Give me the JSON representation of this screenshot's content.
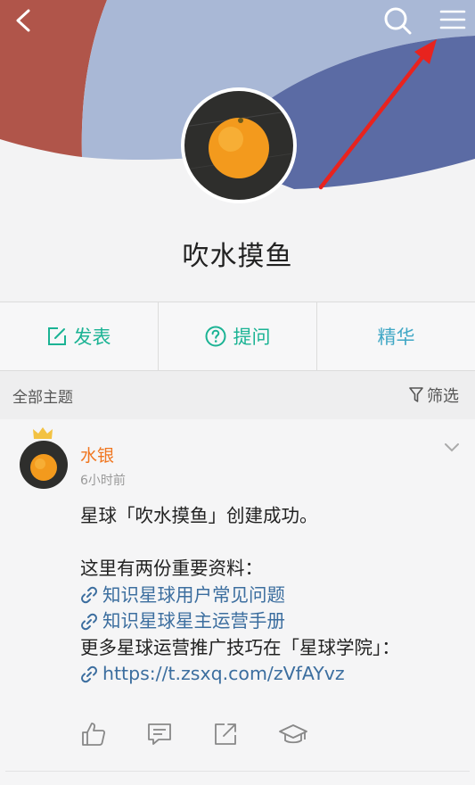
{
  "header": {
    "group_name": "吹水摸鱼"
  },
  "icons": {
    "back": "chevron-left-icon",
    "search": "search-icon",
    "menu": "hamburger-menu-icon"
  },
  "colors": {
    "accent_green": "#1bb394",
    "accent_blue": "#3fa7c5",
    "author_orange": "#f0761f",
    "link_blue": "#3c6e9f",
    "banner_red": "#b0554a",
    "banner_blue": "#5b6ba4",
    "annotation_red": "#e8231e"
  },
  "actions": [
    {
      "label": "发表",
      "icon": "edit-icon"
    },
    {
      "label": "提问",
      "icon": "question-circle-icon"
    },
    {
      "label": "精华"
    }
  ],
  "filterbar": {
    "title": "全部主题",
    "filter_label": "筛选"
  },
  "post": {
    "author": "水银",
    "time": "6小时前",
    "lines": [
      "星球「吹水摸鱼」创建成功。",
      "",
      "这里有两份重要资料：",
      {
        "link": "知识星球用户常见问题"
      },
      {
        "link": "知识星球星主运营手册"
      },
      "更多星球运营推广技巧在「星球学院」：",
      {
        "link": "https://t.zsxq.com/zVfAYvz"
      }
    ],
    "action_icons": [
      "like-icon",
      "comment-icon",
      "share-icon",
      "academy-icon"
    ]
  }
}
